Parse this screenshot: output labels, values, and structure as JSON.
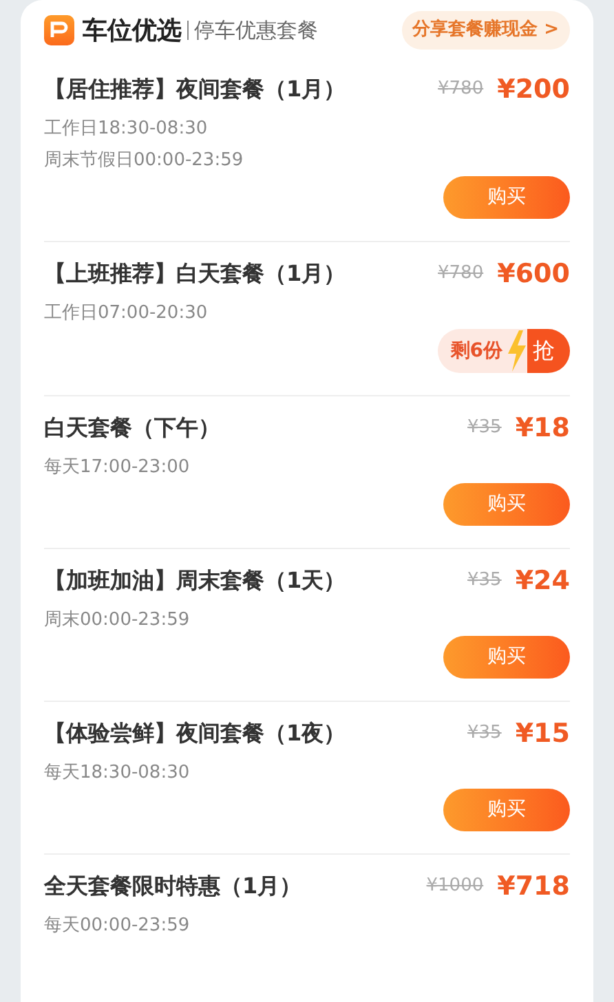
{
  "header": {
    "brand": "车位优选",
    "subtitle": "停车优惠套餐",
    "share_button": "分享套餐赚现金 >"
  },
  "packages": [
    {
      "title": "【居住推荐】夜间套餐（1月）",
      "original_price": "¥780",
      "price": "¥200",
      "times": [
        "工作日18:30-08:30",
        "周末节假日00:00-23:59"
      ],
      "action": {
        "kind": "buy",
        "label": "购买"
      }
    },
    {
      "title": "【上班推荐】白天套餐（1月）",
      "original_price": "¥780",
      "price": "¥600",
      "times": [
        "工作日07:00-20:30"
      ],
      "action": {
        "kind": "limited",
        "stock": "剩6份",
        "label": "抢"
      }
    },
    {
      "title": "白天套餐（下午）",
      "original_price": "¥35",
      "price": "¥18",
      "times": [
        "每天17:00-23:00"
      ],
      "action": {
        "kind": "buy",
        "label": "购买"
      }
    },
    {
      "title": "【加班加油】周末套餐（1天）",
      "original_price": "¥35",
      "price": "¥24",
      "times": [
        "周末00:00-23:59"
      ],
      "action": {
        "kind": "buy",
        "label": "购买"
      }
    },
    {
      "title": "【体验尝鲜】夜间套餐（1夜）",
      "original_price": "¥35",
      "price": "¥15",
      "times": [
        "每天18:30-08:30"
      ],
      "action": {
        "kind": "buy",
        "label": "购买"
      }
    },
    {
      "title": "全天套餐限时特惠（1月）",
      "original_price": "¥1000",
      "price": "¥718",
      "times": [
        "每天00:00-23:59"
      ]
    }
  ]
}
